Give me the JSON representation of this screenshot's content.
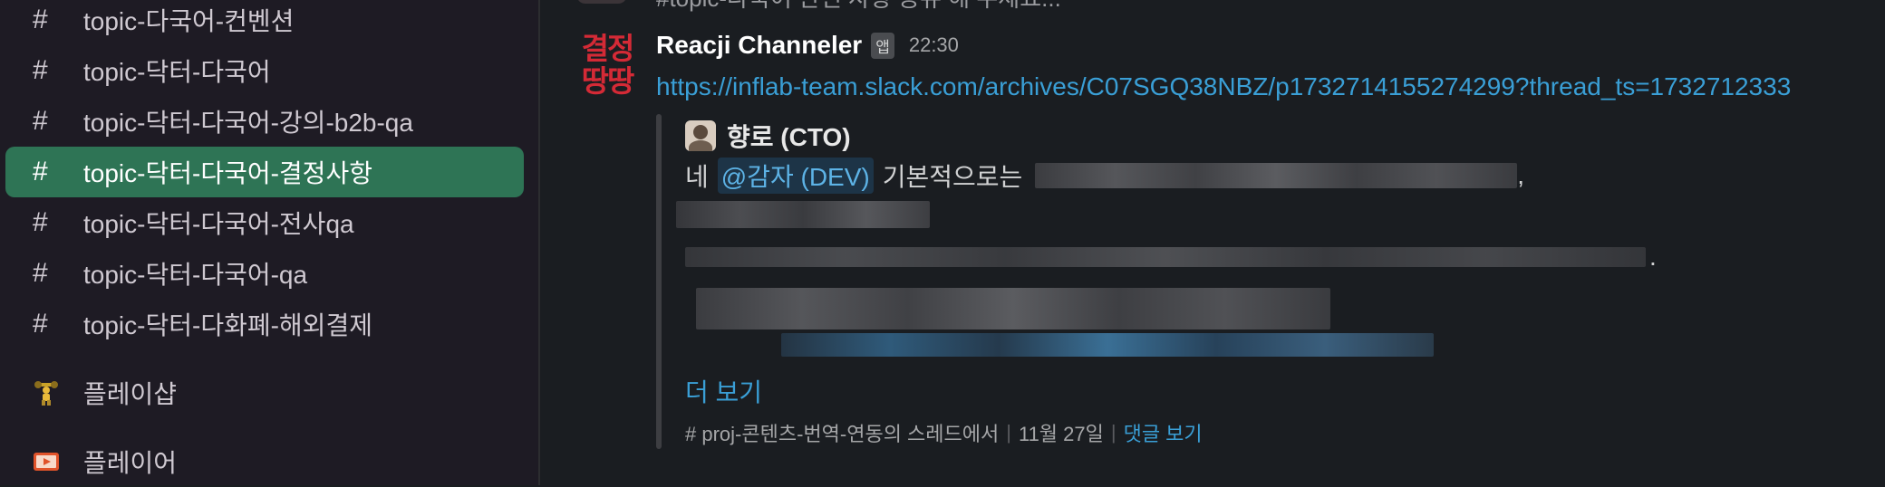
{
  "sidebar": {
    "channels": [
      {
        "label": "topic-다국어-컨벤션",
        "active": false
      },
      {
        "label": "topic-닥터-다국어",
        "active": false
      },
      {
        "label": "topic-닥터-다국어-강의-b2b-qa",
        "active": false
      },
      {
        "label": "topic-닥터-다국어-결정사항",
        "active": true
      },
      {
        "label": "topic-닥터-다국어-전사qa",
        "active": false
      },
      {
        "label": "topic-닥터-다국어-qa",
        "active": false
      },
      {
        "label": "topic-닥터-다화폐-해외결제",
        "active": false
      }
    ],
    "apps": [
      {
        "label": "플레이샵",
        "icon": "weightlifter-icon"
      },
      {
        "label": "플레이어",
        "icon": "film-projector-icon"
      }
    ],
    "hash_symbol": "#"
  },
  "message": {
    "previous_partial": "#topic-다국어 관련 사항 공유 해 주세요...",
    "avatar_text_top": "결정",
    "avatar_text_bottom": "땅땅",
    "author": "Reacji Channeler",
    "badge": "앱",
    "time": "22:30",
    "link": "https://inflab-team.slack.com/archives/C07SGQ38NBZ/p1732714155274299?thread_ts=1732712333",
    "quote": {
      "author": "향로 (CTO)",
      "line1_prefix": "네",
      "mention": "@감자 (DEV)",
      "line1_text": "기본적으로는",
      "line1_suffix": ",",
      "line3_suffix": ".",
      "more_label": "더 보기",
      "footer_source": "# proj-콘텐츠-번역-연동의 스레드에서",
      "footer_date": "11월 27일",
      "footer_reply": "댓글 보기",
      "footer_separator": "|"
    }
  },
  "colors": {
    "sidebar_bg": "#1e1b24",
    "main_bg": "#1a1d21",
    "active_channel": "#2e7455",
    "link": "#3a9fd6",
    "avatar_red": "#d42a36"
  }
}
